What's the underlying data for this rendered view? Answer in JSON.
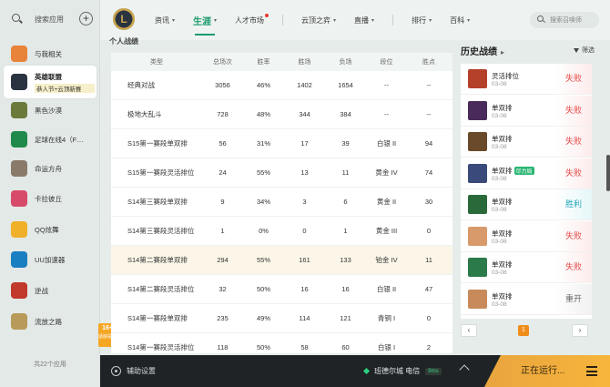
{
  "sidebar": {
    "search_label": "搜索应用",
    "items": [
      {
        "label": "与我相关",
        "icon": "orbit-icon",
        "color": "#e8833a"
      },
      {
        "label": "英雄联盟",
        "sub": "恭人节+云顶新赛",
        "icon": "lol-icon",
        "color": "#2a3340"
      },
      {
        "label": "黑色沙漠",
        "icon": "desert-icon",
        "color": "#6b7a3a"
      },
      {
        "label": "足球在线4（F…",
        "icon": "football-icon",
        "color": "#1f8a4c"
      },
      {
        "label": "命运方舟",
        "icon": "ark-icon",
        "color": "#8a7a6a"
      },
      {
        "label": "卡拉彼丘",
        "icon": "kara-icon",
        "color": "#d84a6a"
      },
      {
        "label": "QQ炫舞",
        "icon": "dance-icon",
        "color": "#f0b02a"
      },
      {
        "label": "UU加速器",
        "icon": "uu-icon",
        "color": "#1a7fc1"
      },
      {
        "label": "逆战",
        "icon": "nizhan-icon",
        "color": "#c0392b"
      },
      {
        "label": "流放之路",
        "icon": "poe-icon",
        "color": "#b89a5a"
      }
    ],
    "footer": "共22个应用"
  },
  "promo": {
    "line1": "16+",
    "line2": "适龄提示"
  },
  "topnav": {
    "items": [
      {
        "label": "资讯",
        "caret": "▾"
      },
      {
        "label": "生涯",
        "caret": "▾",
        "active": true
      },
      {
        "label": "人才市场",
        "dot": true
      },
      {
        "label": "云顶之弈",
        "caret": "▾"
      },
      {
        "label": "直播",
        "caret": "▾"
      },
      {
        "label": "排行",
        "caret": "▾"
      },
      {
        "label": "百科",
        "caret": "▾"
      }
    ],
    "search_placeholder": "搜索召唤师"
  },
  "main": {
    "heading": "个人战绩",
    "columns": [
      "类型",
      "总场次",
      "胜率",
      "胜场",
      "负场",
      "段位",
      "胜点"
    ],
    "rows": [
      [
        "经典对战",
        "3056",
        "46%",
        "1402",
        "1654",
        "--",
        "--"
      ],
      [
        "极地大乱斗",
        "728",
        "48%",
        "344",
        "384",
        "--",
        "--"
      ],
      [
        "S15第一赛段单双排",
        "56",
        "31%",
        "17",
        "39",
        "白银 II",
        "94"
      ],
      [
        "S15第一赛段灵活排位",
        "24",
        "55%",
        "13",
        "11",
        "黄金 IV",
        "74"
      ],
      [
        "S14第三赛段单双排",
        "9",
        "34%",
        "3",
        "6",
        "黄金 II",
        "30"
      ],
      [
        "S14第三赛段灵活排位",
        "1",
        "0%",
        "0",
        "1",
        "黄金 III",
        "0"
      ],
      [
        "S14第二赛段单双排",
        "294",
        "55%",
        "161",
        "133",
        "铂金 IV",
        "11"
      ],
      [
        "S14第二赛段灵活排位",
        "32",
        "50%",
        "16",
        "16",
        "白银 II",
        "47"
      ],
      [
        "S14第一赛段单双排",
        "235",
        "49%",
        "114",
        "121",
        "青铜 I",
        "0"
      ],
      [
        "S14第一赛段灵活排位",
        "118",
        "50%",
        "58",
        "60",
        "白银 I",
        "2"
      ]
    ]
  },
  "history": {
    "title": "历史战绩",
    "arrow": "▸",
    "filter": "筛选",
    "items": [
      {
        "mode": "灵活排位",
        "date": "03-08",
        "result": "失败",
        "kind": "lose",
        "avatar": "#b5402a"
      },
      {
        "mode": "单双排",
        "date": "03-08",
        "result": "失败",
        "kind": "lose",
        "avatar": "#4a2a5a"
      },
      {
        "mode": "单双排",
        "date": "03-08",
        "result": "失败",
        "kind": "lose",
        "avatar": "#6a4a2a"
      },
      {
        "mode": "单双排",
        "tag": "尽力局",
        "date": "03-08",
        "result": "失败",
        "kind": "lose",
        "avatar": "#3a4a7a"
      },
      {
        "mode": "单双排",
        "date": "03-08",
        "result": "胜利",
        "kind": "win",
        "avatar": "#2a6a3a"
      },
      {
        "mode": "单双排",
        "date": "03-08",
        "result": "失败",
        "kind": "lose",
        "avatar": "#d89a6a"
      },
      {
        "mode": "单双排",
        "date": "03-08",
        "result": "失败",
        "kind": "lose",
        "avatar": "#2a7a4a"
      },
      {
        "mode": "单双排",
        "date": "03-08",
        "result": "重开",
        "kind": "redo",
        "avatar": "#c88a5a"
      }
    ],
    "pager": {
      "prev": "‹",
      "page": "1",
      "next": "›"
    }
  },
  "bottombar": {
    "assist": "辅助设置",
    "server": "班德尔城 电信",
    "ping": "9ms",
    "running": "正在运行..."
  }
}
